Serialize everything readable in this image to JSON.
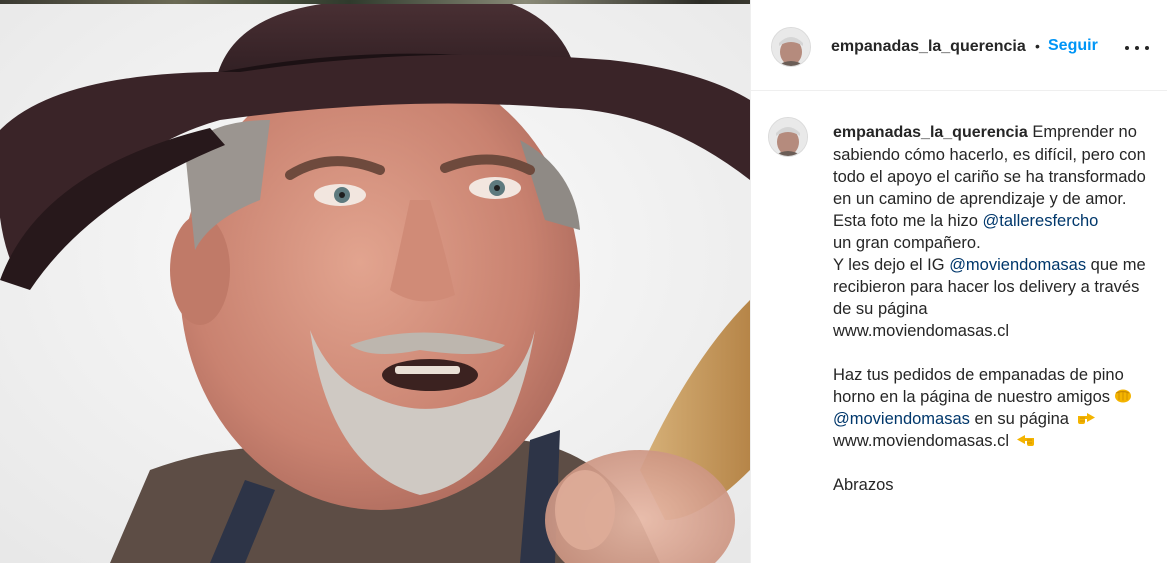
{
  "post": {
    "username": "empanadas_la_querencia",
    "separator": "•",
    "follow_label": "Seguir",
    "more_options_icon": "more-horizontal-icon"
  },
  "caption": {
    "username": "empanadas_la_querencia",
    "line1": " Emprender no sabiendo cómo hacerlo, es difícil, pero con todo el apoyo el cariño se ha transformado en un camino de aprendizaje y de amor.",
    "line2_prefix": "Esta foto me la hizo ",
    "line2_mention": "@talleresfercho",
    "line3": "un gran compañero.",
    "line4_prefix": "Y les dejo el IG ",
    "line4_mention": "@moviendomasas",
    "line4_suffix": " que me recibieron para hacer los delivery a través de su página",
    "line5": "www.moviendomasas.cl",
    "line6": "Haz tus pedidos de empanadas de pino horno en la página de nuestro amigos",
    "line7_mention": "@moviendomasas",
    "line7_suffix": " en su página ",
    "line8": "www.moviendomasas.cl ",
    "line9": "Abrazos"
  },
  "icons": {
    "fist_emoji": "oncoming-fist-icon",
    "point_right_emoji": "point-right-icon",
    "point_left_emoji": "point-left-icon"
  },
  "colors": {
    "follow": "#0095f6",
    "mention": "#00376b",
    "text": "#262626"
  }
}
